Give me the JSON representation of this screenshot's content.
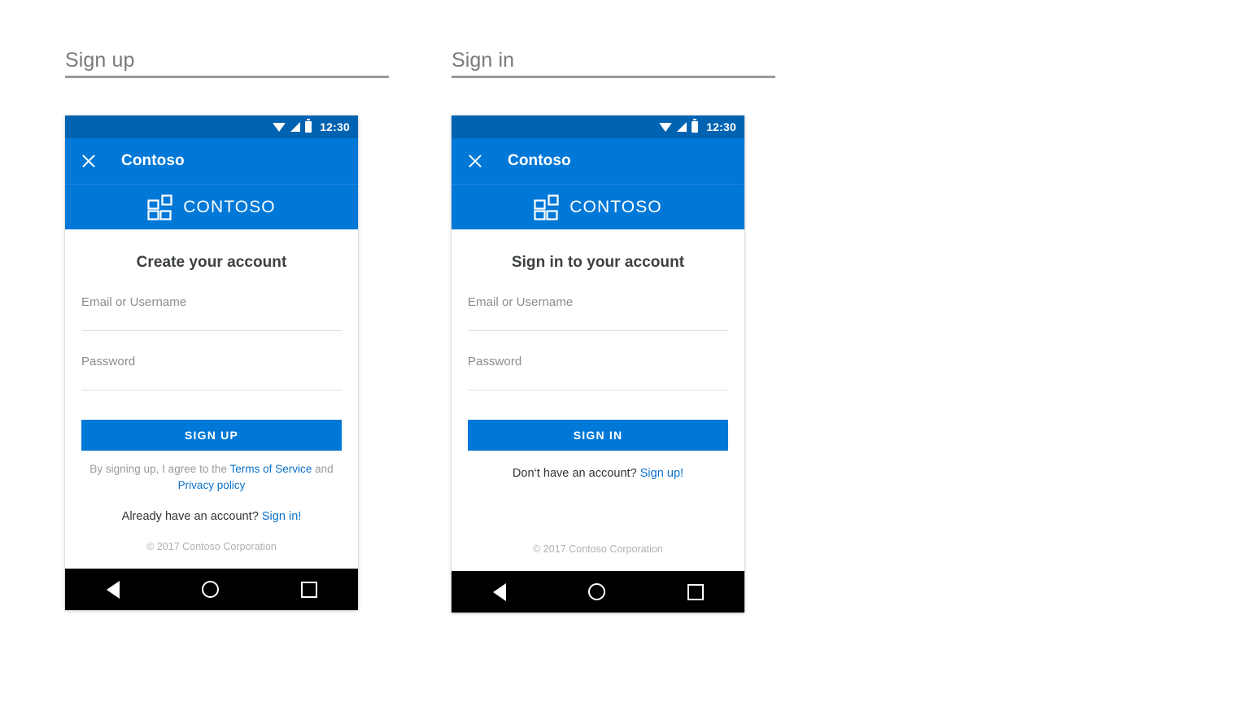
{
  "page": {
    "background": "#ffffff",
    "accent_blue": "#0078d7",
    "status_bar_blue": "#0063b1",
    "link_blue": "#0a71c8"
  },
  "sections": [
    {
      "title": "Sign up",
      "phone": {
        "status_bar": {
          "time": "12:30",
          "icons": [
            "wifi-icon",
            "signal-icon",
            "battery-icon"
          ]
        },
        "app_bar": {
          "close_icon": "close-icon",
          "title": "Contoso"
        },
        "brand": {
          "logo_icon": "contoso-grid-logo-icon",
          "name": "CONTOSO"
        },
        "form": {
          "heading": "Create your account",
          "fields": [
            {
              "label": "Email or Username",
              "value": ""
            },
            {
              "label": "Password",
              "value": ""
            }
          ],
          "button": "SIGN UP",
          "legal": {
            "lead": "By signing up, I agree to the ",
            "link1": "Terms of Service",
            "middle": " and ",
            "link2": "Privacy policy"
          },
          "alt_prompt": {
            "text": "Already have an account? ",
            "link": "Sign in!"
          },
          "copyright": "© 2017 Contoso Corporation"
        },
        "nav_bar": {
          "back": "back-nav-icon",
          "home": "home-nav-icon",
          "recents": "recents-nav-icon"
        }
      }
    },
    {
      "title": "Sign in",
      "phone": {
        "status_bar": {
          "time": "12:30",
          "icons": [
            "wifi-icon",
            "signal-icon",
            "battery-icon"
          ]
        },
        "app_bar": {
          "close_icon": "close-icon",
          "title": "Contoso"
        },
        "brand": {
          "logo_icon": "contoso-grid-logo-icon",
          "name": "CONTOSO"
        },
        "form": {
          "heading": "Sign in to your account",
          "fields": [
            {
              "label": "Email or Username",
              "value": ""
            },
            {
              "label": "Password",
              "value": ""
            }
          ],
          "button": "SIGN IN",
          "alt_prompt": {
            "text": "Don‘t have an account? ",
            "link": "Sign up!"
          },
          "copyright": "© 2017 Contoso Corporation"
        },
        "nav_bar": {
          "back": "back-nav-icon",
          "home": "home-nav-icon",
          "recents": "recents-nav-icon"
        }
      }
    }
  ]
}
